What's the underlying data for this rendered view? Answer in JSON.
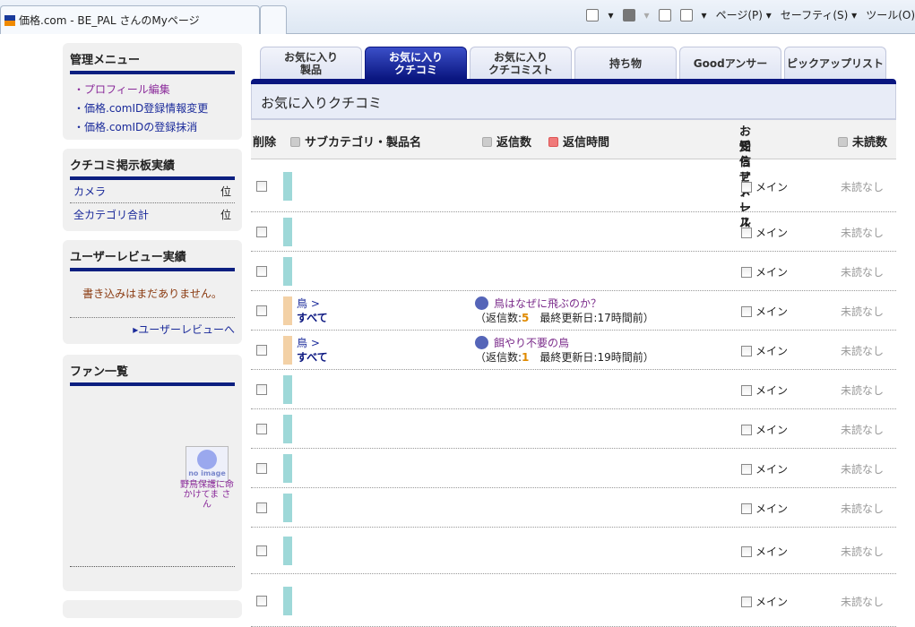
{
  "browser": {
    "tab_title": "価格.com - BE_PAL さんのMyページ",
    "menu": [
      "ページ(P)",
      "セーフティ(S)",
      "ツール(O)"
    ]
  },
  "sidebar": {
    "admin": {
      "title": "管理メニュー",
      "items": [
        "・プロフィール編集",
        "・価格.comID登録情報変更",
        "・価格.comIDの登録抹消"
      ]
    },
    "kuchikomi": {
      "title": "クチコミ掲示板実績",
      "rows": [
        {
          "label": "カメラ",
          "rank": "位"
        },
        {
          "label": "全カテゴリ合計",
          "rank": "位"
        }
      ]
    },
    "review": {
      "title": "ユーザーレビュー実績",
      "empty": "書き込みはまだありません。",
      "link": "ユーザーレビューへ"
    },
    "fans": {
      "title": "ファン一覧",
      "noimage": "no image",
      "fan_name": "野鳥保護に命かけてま さん"
    }
  },
  "tabs": [
    {
      "label": "お気に入り\n製品"
    },
    {
      "label": "お気に入り\nクチコミ",
      "active": true
    },
    {
      "label": "お気に入り\nクチコミスト"
    },
    {
      "label": "持ち物"
    },
    {
      "label": "Goodアンサー"
    },
    {
      "label": "ピックアップリスト"
    }
  ],
  "section_title": "お気に入りクチコミ",
  "columns": {
    "delete": "削除",
    "subcat": "サブカテゴリ・製品名",
    "replies": "返信数",
    "reply_time": "返信時間",
    "mail1": "お知らせメール",
    "mail2": "受信アドレス",
    "unread": "未読数"
  },
  "rows": [
    {
      "bar": "#9ed8d8"
    },
    {
      "bar": "#9ed8d8"
    },
    {
      "bar": "#9ed8d8"
    },
    {
      "bar": "#f3d1a6",
      "cat": "鳥 >",
      "sub": "すべて",
      "title": "鳥はなぜに飛ぶのか？",
      "pre": "（返信数:",
      "count": "5",
      "post": "　最終更新日:17時間前）"
    },
    {
      "bar": "#f3d1a6",
      "cat": "鳥 >",
      "sub": "すべて",
      "title": "餌やり不要の鳥",
      "pre": "（返信数:",
      "count": "1",
      "post": "　最終更新日:19時間前）"
    },
    {
      "bar": "#9ed8d8"
    },
    {
      "bar": "#9ed8d8"
    },
    {
      "bar": "#9ed8d8"
    },
    {
      "bar": "#9ed8d8"
    },
    {
      "bar": "#9ed8d8"
    },
    {
      "bar": "#9ed8d8"
    }
  ],
  "mail_label": "メイン",
  "unread_label": "未読なし"
}
